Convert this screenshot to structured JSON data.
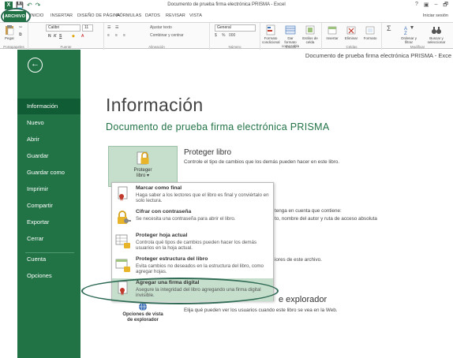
{
  "window": {
    "title": "Documento de prueba firma electrónica PRISMA - Excel",
    "app_icon": "excel-icon",
    "controls": [
      "?",
      "▣",
      "–",
      "🗗"
    ]
  },
  "tabs": [
    "ARCHIVO",
    "INICIO",
    "INSERTAR",
    "DISEÑO DE PÁGINA",
    "FÓRMULAS",
    "DATOS",
    "REVISAR",
    "VISTA"
  ],
  "signin": "Iniciar sesión",
  "ribbon": {
    "paste_label": "Pegar",
    "font_name": "Calibri",
    "font_size": "11",
    "bold": "N",
    "italic": "K",
    "underline": "S",
    "wrap_text": "Ajustar texto",
    "merge_center": "Combinar y centrar",
    "number_format": "General",
    "percent": "%",
    "thousands": "000",
    "cond_format": "Formato condicional",
    "format_table": "Dar formato como tabla",
    "cell_styles": "Estilos de celda",
    "insert": "Insertar",
    "delete": "Eliminar",
    "format": "Formato",
    "sort_filter": "Ordenar y filtrar",
    "find_select": "Buscar y seleccionar",
    "groups": [
      "Portapapeles",
      "Fuente",
      "Alineación",
      "Número",
      "Estilos",
      "Celdas",
      "Modificar"
    ]
  },
  "breadcrumb_title": "Documento de prueba firma electrónica PRISMA - Exce",
  "sidebar": {
    "back_icon": "back-arrow-icon",
    "items": [
      "Información",
      "Nuevo",
      "Abrir",
      "Guardar",
      "Guardar como",
      "Imprimir",
      "Compartir",
      "Exportar",
      "Cerrar",
      "Cuenta",
      "Opciones"
    ]
  },
  "main": {
    "title": "Información",
    "subtitle": "Documento de  prueba firma electrónica PRISMA",
    "protect": {
      "button_label_1": "Proteger",
      "button_label_2": "libro ▾",
      "heading": "Proteger libro",
      "description": "Controle el tipo de cambios que los demás pueden hacer en este libro."
    },
    "inspect_partial_1": "tenga en cuenta que contiene:",
    "inspect_partial_2": "to, nombre del autor y ruta de acceso absoluta",
    "versions_partial": "iores de este archivo.",
    "browser": {
      "heading_partial": "e explorador",
      "description": "Elija qué pueden ver los usuarios cuando este libro se vea en la Web.",
      "button_label_1": "Opciones de vista",
      "button_label_2": "de explorador"
    }
  },
  "menu": {
    "items": [
      {
        "title": "Marcar como final",
        "desc": "Haga saber a los lectores que el libro es final y conviértalo en solo lectura.",
        "icon": "document-ribbon-icon"
      },
      {
        "title": "Cifrar con contraseña",
        "desc": "Se necesita una contraseña para abrir el libro.",
        "icon": "lock-key-icon"
      },
      {
        "title": "Proteger hoja actual",
        "desc": "Controla qué tipos de cambios pueden hacer los demás usuarios en la hoja actual.",
        "icon": "sheet-lock-icon"
      },
      {
        "title": "Proteger estructura del libro",
        "desc": "Evita cambios no deseados en la estructura del libro, como agregar hojas.",
        "icon": "workbook-lock-icon"
      },
      {
        "title": "Agregar una firma digital",
        "desc": "Asegure la integridad del libro agregando una firma digital invisible.",
        "icon": "signature-ribbon-icon"
      }
    ]
  },
  "colors": {
    "excel_green": "#217346",
    "sidebar_active": "#0f5c35",
    "hover_green": "#c6dfcc",
    "annotation_ring": "#2e6a54"
  }
}
